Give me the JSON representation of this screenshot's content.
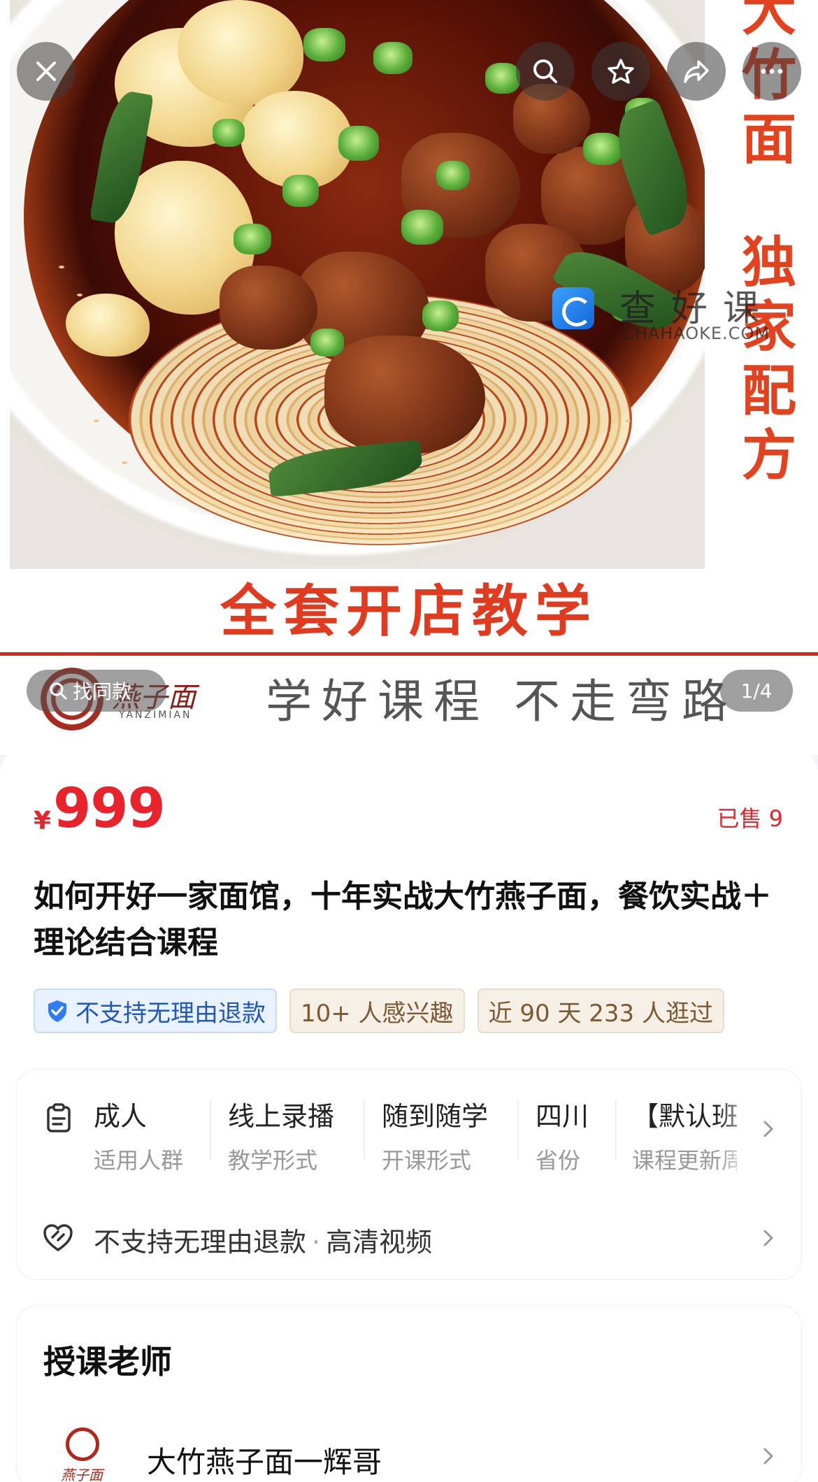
{
  "hero": {
    "side_text_top": [
      "大",
      "竹",
      "面"
    ],
    "side_text_bottom": [
      "独",
      "家",
      "配",
      "方"
    ],
    "banner": "全套开店教学",
    "logo_brand": "燕子面",
    "logo_sub": "YANZIMIAN",
    "slogan": "学好课程 不走弯路",
    "watermark_title": "查好课",
    "watermark_url": "CHAHAOKE.COM",
    "find_similar_label": "找同款",
    "page_indicator": "1/4"
  },
  "controls": {
    "close_icon": "close-icon",
    "search_icon": "search-icon",
    "favorite_icon": "star-icon",
    "share_icon": "share-icon",
    "more_icon": "more-icon"
  },
  "product": {
    "currency": "¥",
    "price": "999",
    "sold": "已售 9",
    "title": "如何开好一家面馆，十年实战大竹燕子面，餐饮实战＋理论结合课程",
    "tags": {
      "refund": "不支持无理由退款",
      "interest": "10+ 人感兴趣",
      "visits": "近 90 天 233 人逛过"
    }
  },
  "attributes": {
    "items": [
      {
        "value": "成人",
        "key": "适用人群"
      },
      {
        "value": "线上录播",
        "key": "教学形式"
      },
      {
        "value": "随到随学",
        "key": "开课形式"
      },
      {
        "value": "四川",
        "key": "省份"
      },
      {
        "value": "【默认班",
        "key": "课程更新周"
      }
    ],
    "refund_text": "不支持无理由退款",
    "separator": "·",
    "video_text": "高清视频"
  },
  "teacher": {
    "section_title": "授课老师",
    "avatar_text": "燕子面",
    "name": "大竹燕子面一辉哥"
  },
  "colors": {
    "accent_red": "#e8232b",
    "banner_red": "#e03a1f",
    "tag_blue": "#2057b8",
    "tag_brown": "#7b5a33"
  }
}
